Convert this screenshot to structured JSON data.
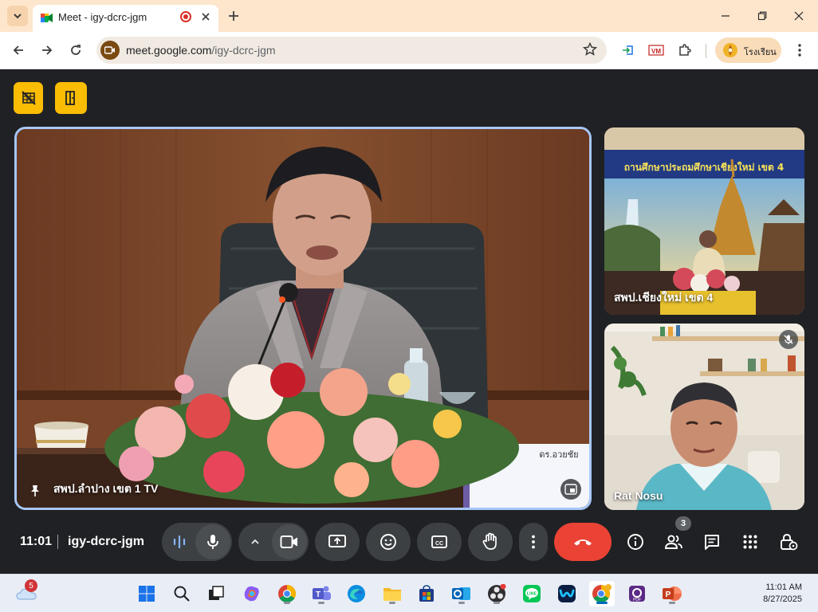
{
  "browser": {
    "tab_title": "Meet - igy-dcrc-jgm",
    "url_host": "meet.google.com",
    "url_path": "/igy-dcrc-jgm",
    "profile_name": "โรงเรียน"
  },
  "meet": {
    "time": "11:01",
    "meeting_code": "igy-dcrc-jgm",
    "participants_count": "3",
    "main_tile": {
      "name": "สพป.ลำปาง เขต 1 TV",
      "name_plate": "ดร.อวยชัย"
    },
    "side_tiles": [
      {
        "name": "สพป.เชียงใหม่ เขต 4",
        "banner": "ถานศึกษาประถมศึกษาเชียงใหม่ เขต 4"
      },
      {
        "name": "Rat Nosu",
        "muted": true
      }
    ]
  },
  "taskbar": {
    "weather_badge": "5",
    "time": "11:01 AM",
    "date": "8/27/2025",
    "apps": [
      "start",
      "search",
      "task-view",
      "copilot",
      "chrome",
      "teams",
      "edge",
      "file-explorer",
      "store",
      "outlook",
      "obs",
      "line",
      "webex",
      "chrome-profile",
      "pdf-editor",
      "powerpoint"
    ]
  },
  "colors": {
    "accent_yellow": "#fbbc04",
    "end_call": "#ea4335",
    "tile_highlight": "#a8c7fa"
  }
}
